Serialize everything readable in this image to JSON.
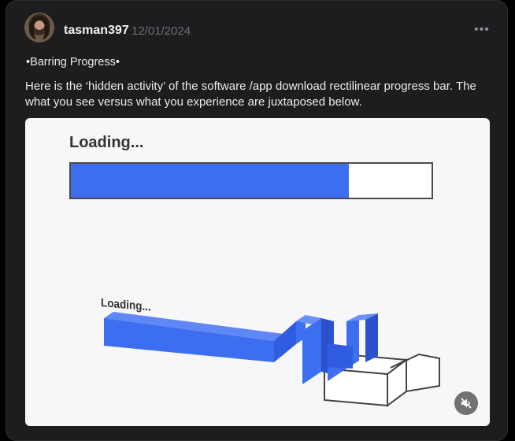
{
  "post": {
    "username": "tasman397",
    "date": "12/01/2024",
    "more_icon": "•••",
    "title": "•Barring Progress•",
    "body": "Here is the ‘hidden activity’ of the software /app download rectilinear progress bar. The what you see versus what you experience are juxtaposed below."
  },
  "media": {
    "top_label": "Loading...",
    "top_progress": 0.77,
    "bottom_label": "Loading...",
    "mute_icon": "speaker-muted-icon",
    "fill_color": "#3d6ef0"
  }
}
